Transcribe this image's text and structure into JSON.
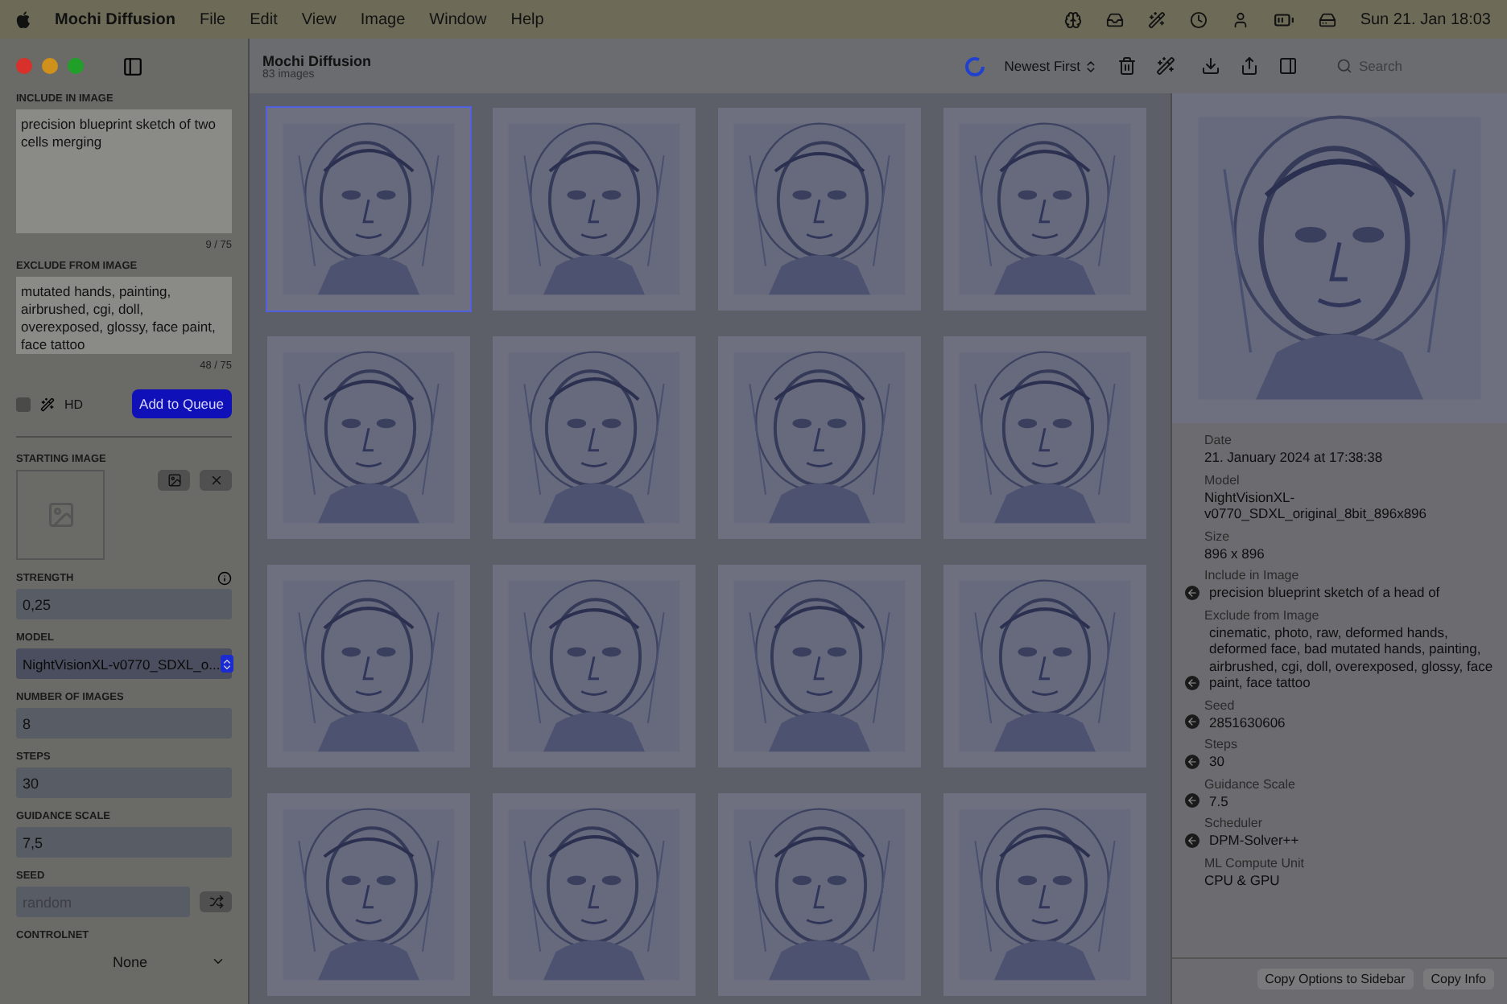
{
  "menu_bar": {
    "app": "Mochi Diffusion",
    "menus": [
      "File",
      "Edit",
      "View",
      "Image",
      "Window",
      "Help"
    ],
    "clock": "Sun 21. Jan 18:03"
  },
  "window": {
    "title": "Mochi Diffusion",
    "subtitle": "83 images"
  },
  "toolbar": {
    "sort": "Newest First",
    "search": {
      "placeholder": "Search"
    }
  },
  "sidebar": {
    "include": {
      "label": "INCLUDE IN IMAGE",
      "value": "precision blueprint sketch of two cells merging",
      "count": "9 / 75"
    },
    "exclude": {
      "label": "EXCLUDE FROM IMAGE",
      "value": "mutated hands, painting, airbrushed, cgi, doll, overexposed, glossy, face paint, face tattoo",
      "count": "48 / 75"
    },
    "hd": {
      "label": "HD",
      "checked": false
    },
    "queue_button": "Add to Queue",
    "starting_image": {
      "label": "STARTING IMAGE"
    },
    "fields": [
      {
        "kind": "text",
        "label": "STRENGTH",
        "value": "0,25",
        "info": true
      },
      {
        "kind": "select",
        "label": "MODEL",
        "value": "NightVisionXL-v0770_SDXL_o..."
      },
      {
        "kind": "text",
        "label": "NUMBER OF IMAGES",
        "value": "8"
      },
      {
        "kind": "text",
        "label": "STEPS",
        "value": "30"
      },
      {
        "kind": "text",
        "label": "GUIDANCE SCALE",
        "value": "7,5"
      },
      {
        "kind": "seed",
        "label": "SEED",
        "placeholder": "random"
      },
      {
        "kind": "dropdown",
        "label": "CONTROLNET",
        "value": "None"
      }
    ]
  },
  "gallery": {
    "images": [
      {
        "selected": true
      },
      {
        "selected": false
      },
      {
        "selected": false
      },
      {
        "selected": false
      },
      {
        "selected": false
      },
      {
        "selected": false
      },
      {
        "selected": false
      },
      {
        "selected": false
      },
      {
        "selected": false
      },
      {
        "selected": false
      },
      {
        "selected": false
      },
      {
        "selected": false
      },
      {
        "selected": false
      },
      {
        "selected": false
      },
      {
        "selected": false
      },
      {
        "selected": false
      }
    ]
  },
  "info": {
    "fields": [
      {
        "label": "Date",
        "value": "21. January 2024 at 17:38:38",
        "copy": false
      },
      {
        "label": "Model",
        "value": "NightVisionXL-v0770_SDXL_original_8bit_896x896",
        "copy": false
      },
      {
        "label": "Size",
        "value": "896 x 896",
        "copy": false
      },
      {
        "label": "Include in Image",
        "value": "precision blueprint sketch of a head of",
        "copy": true
      },
      {
        "label": "Exclude from Image",
        "value": "cinematic, photo, raw, deformed hands, deformed face, bad mutated hands, painting, airbrushed, cgi, doll, overexposed, glossy, face paint, face tattoo",
        "copy": true
      },
      {
        "label": "Seed",
        "value": "2851630606",
        "copy": true
      },
      {
        "label": "Steps",
        "value": "30",
        "copy": true
      },
      {
        "label": "Guidance Scale",
        "value": "7.5",
        "copy": true
      },
      {
        "label": "Scheduler",
        "value": "DPM-Solver++",
        "copy": true
      },
      {
        "label": "ML Compute Unit",
        "value": "CPU & GPU",
        "copy": false
      }
    ],
    "buttons": [
      "Copy Options to Sidebar",
      "Copy Info"
    ]
  }
}
